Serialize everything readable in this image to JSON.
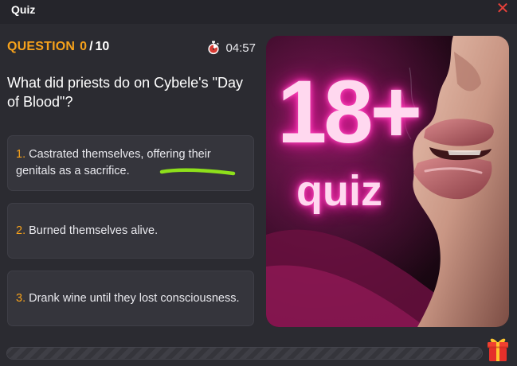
{
  "window": {
    "title": "Quiz"
  },
  "header": {
    "question_label": "QUESTION",
    "current": "0",
    "separator": "/",
    "total": "10",
    "timer": "04:57"
  },
  "question": {
    "text": "What did priests do on Cybele's \"Day of Blood\"?"
  },
  "answers": [
    {
      "number": "1.",
      "text": "Castrated themselves, offering their genitals as a sacrifice."
    },
    {
      "number": "2.",
      "text": "Burned themselves alive."
    },
    {
      "number": "3.",
      "text": "Drank wine until they lost consciousness."
    }
  ],
  "promo": {
    "big_text": "18+",
    "small_text": "quiz"
  },
  "progress": {
    "fraction": 0.0
  },
  "colors": {
    "accent": "#f7a21b",
    "close": "#e8413a",
    "background": "#2b2b31",
    "answer_bg": "#35353c",
    "neon": "#ff2ab0",
    "underline": "#8ee01b"
  },
  "icons": {
    "close": "close-icon",
    "timer": "stopwatch-icon",
    "gift": "gift-icon"
  }
}
